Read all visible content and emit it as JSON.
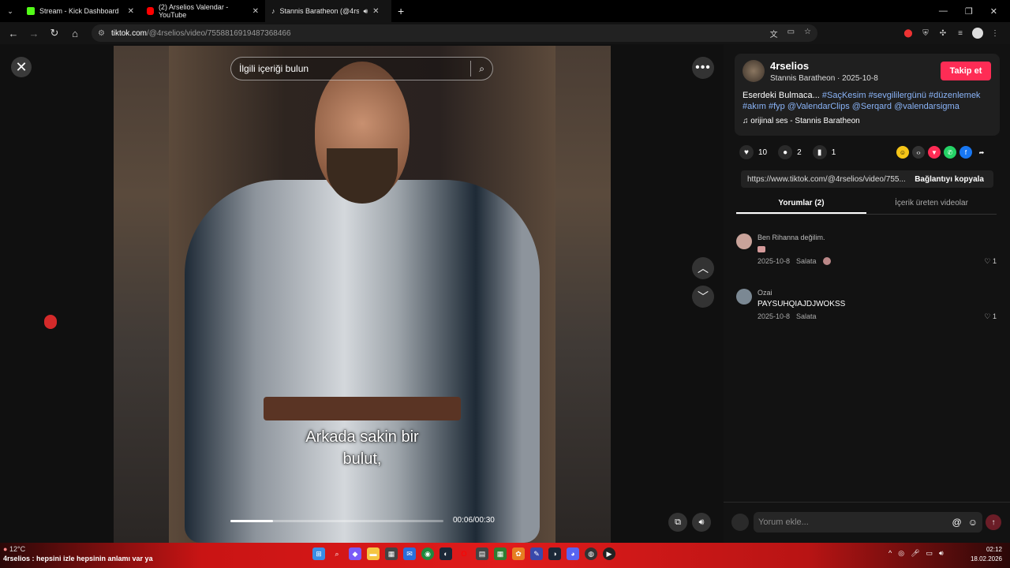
{
  "browser": {
    "tabs": [
      {
        "label": "Stream - Kick Dashboard",
        "color": "#53fc18"
      },
      {
        "label": "(2) Arselios Valendar - YouTube",
        "color": "#ff0000"
      },
      {
        "label": "Stannis Baratheon (@4rseli...",
        "color": "#ffffff"
      }
    ],
    "new_tab": "+",
    "url_host": "tiktok.com",
    "url_path": "/@4rselios/video/7558816919487368466"
  },
  "video": {
    "search_placeholder": "İlgili içeriği bulun",
    "caption_line1": "Arkada sakin bir",
    "caption_line2": "bulut,",
    "time": "00:06/00:30",
    "progress": 0.2
  },
  "post": {
    "username": "4rselios",
    "subline": "Stannis Baratheon · 2025-10-8",
    "follow_label": "Takip et",
    "desc_text": "Eserdeki Bulmaca... ",
    "desc_tags": "#SaçKesim #sevgililergünü #düzenlemek #akım #fyp @ValendarClips @Serqard @valendarsigma",
    "music": "orijinal ses - Stannis Baratheon",
    "likes": "10",
    "comments": "2",
    "saves": "1",
    "link": "https://www.tiktok.com/@4rselios/video/755...",
    "copy_label": "Bağlantıyı kopyala",
    "tab_comments": "Yorumlar (2)",
    "tab_creator": "İçerik üreten videolar"
  },
  "comments": [
    {
      "name": "Ben Rihanna değilim.",
      "text": "",
      "date": "2025-10-8",
      "tag": "Salata",
      "likes": "1",
      "avatar_color": "#c9a39a"
    },
    {
      "name": "Ozai",
      "text": "PAYSUHQIAJDJWOKSS",
      "date": "2025-10-8",
      "tag": "Salata",
      "likes": "1",
      "avatar_color": "#7b8893"
    }
  ],
  "comment_input": {
    "placeholder": "Yorum ekle..."
  },
  "taskbar": {
    "temperature": "12°C",
    "headline": "4rselios : hepsini izle hepsinin anlamı var ya",
    "time": "02:12",
    "date": "18.02.2026"
  }
}
